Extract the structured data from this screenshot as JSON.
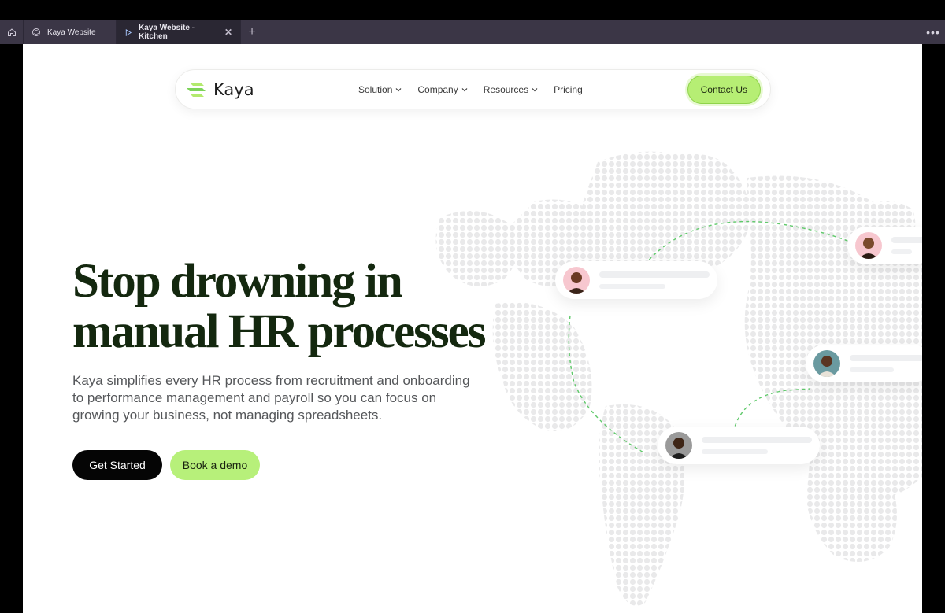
{
  "browser": {
    "tabs": [
      {
        "label": "Kaya Website"
      },
      {
        "label": "Kaya Website - Kitchen"
      }
    ]
  },
  "nav": {
    "logo": "Kaya",
    "items": [
      "Solution",
      "Company",
      "Resources",
      "Pricing"
    ],
    "contact": "Contact Us"
  },
  "hero": {
    "title_line1": "Stop drowning in",
    "title_line2": "manual HR processes",
    "subtitle": "Kaya simplifies every HR process from recruitment and onboarding to performance management and payroll so you can focus on growing your business, not managing spreadsheets.",
    "cta_primary": "Get Started",
    "cta_secondary": "Book a demo"
  },
  "colors": {
    "accent_green": "#b7f07a",
    "title_green": "#14280f",
    "tabbar": "#3b3646"
  }
}
